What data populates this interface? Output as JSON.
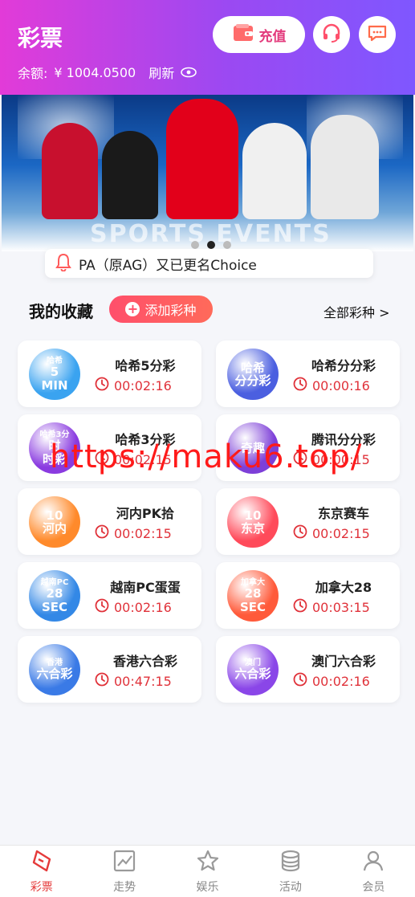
{
  "header": {
    "title": "彩票",
    "balance_label": "余额:",
    "balance_value": "¥ 1004.0500",
    "refresh_label": "刷新",
    "recharge_label": "充值",
    "icons": [
      "headset-icon",
      "chat-icon",
      "eye-icon",
      "wallet-icon"
    ]
  },
  "banner": {
    "text": "SPORTS EVENTS",
    "dots": 3,
    "active_dot": 2
  },
  "notice": {
    "text": "PA（原AG）又已更名Choice",
    "icon": "bell-icon"
  },
  "favorites": {
    "title": "我的收藏",
    "add_label": "添加彩种",
    "all_label": "全部彩种 >"
  },
  "games": [
    {
      "name": "哈希5分彩",
      "time": "00:02:16",
      "icon_text": "5\nMIN",
      "badge": "哈希",
      "color": "#3aa3f0"
    },
    {
      "name": "哈希分分彩",
      "time": "00:00:16",
      "icon_text": "哈希\n分分彩",
      "badge": "",
      "color": "#4b5fe0"
    },
    {
      "name": "哈希3分彩",
      "time": "00:02:15",
      "icon_text": "时\n时彩",
      "badge": "哈希3分",
      "color": "#8a3be0"
    },
    {
      "name": "腾讯分分彩",
      "time": "00:00:15",
      "icon_text": "奇趣",
      "badge": "",
      "color": "#7d3fd8"
    },
    {
      "name": "河内PK拾",
      "time": "00:02:15",
      "icon_text": "10\n河内",
      "badge": "",
      "color": "#ff8a2b"
    },
    {
      "name": "东京赛车",
      "time": "00:02:15",
      "icon_text": "10\n东京",
      "badge": "",
      "color": "#ff4a5a"
    },
    {
      "name": "越南PC蛋蛋",
      "time": "00:02:16",
      "icon_text": "28\nSEC",
      "badge": "越南PC",
      "color": "#3388e6"
    },
    {
      "name": "加拿大28",
      "time": "00:03:15",
      "icon_text": "28\nSEC",
      "badge": "加拿大",
      "color": "#ff5a3a"
    },
    {
      "name": "香港六合彩",
      "time": "00:47:15",
      "icon_text": "六合彩",
      "badge": "香港",
      "color": "#3a7ae6"
    },
    {
      "name": "澳门六合彩",
      "time": "00:02:16",
      "icon_text": "六合彩",
      "badge": "澳门",
      "color": "#8a46e8"
    }
  ],
  "watermark": "https://maku6.top/",
  "nav": [
    {
      "label": "彩票",
      "icon": "lottery-icon",
      "active": true
    },
    {
      "label": "走势",
      "icon": "trend-icon",
      "active": false
    },
    {
      "label": "娱乐",
      "icon": "star-icon",
      "active": false
    },
    {
      "label": "活动",
      "icon": "coins-icon",
      "active": false
    },
    {
      "label": "会员",
      "icon": "user-icon",
      "active": false
    }
  ],
  "colors": {
    "accent": "#e0323a",
    "header_start": "#e23bd8",
    "header_end": "#7f57ff"
  }
}
